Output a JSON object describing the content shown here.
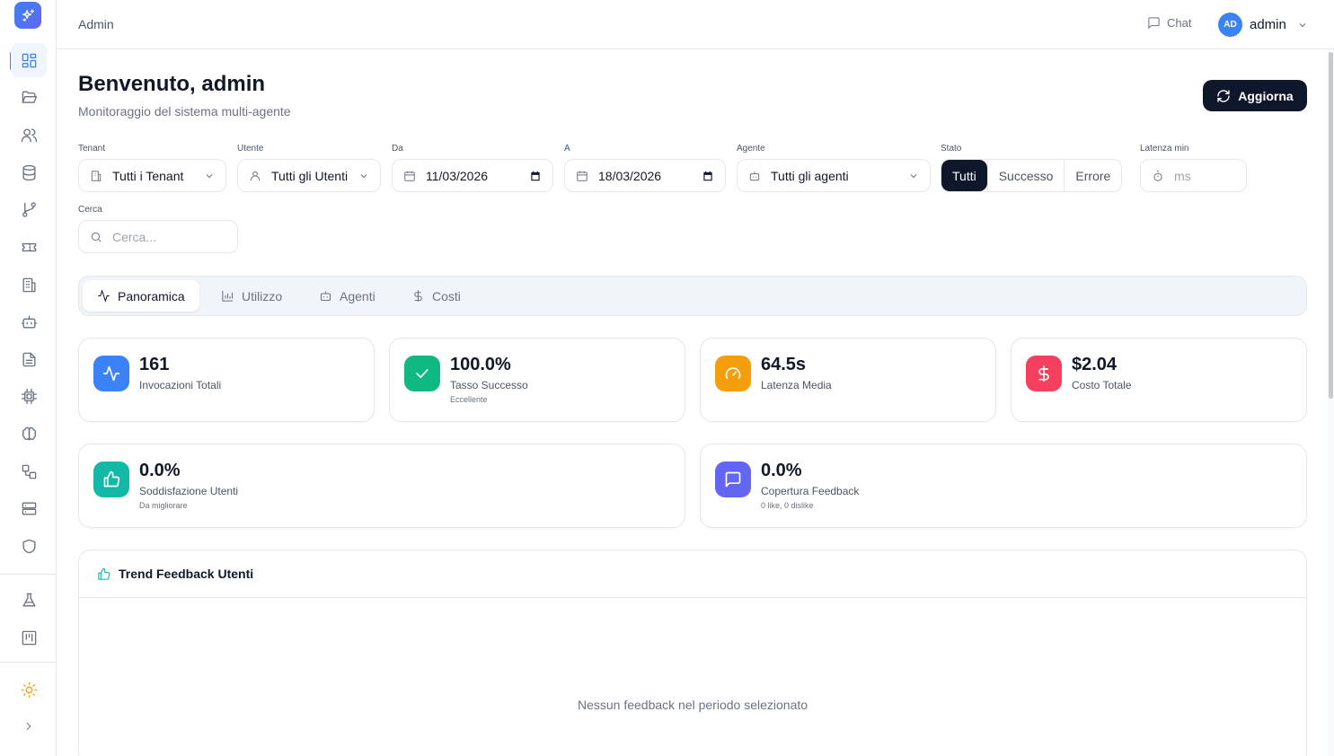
{
  "topbar": {
    "breadcrumb": "Admin",
    "chat_label": "Chat",
    "user_initials": "AD",
    "user_name": "admin"
  },
  "header": {
    "title": "Benvenuto, admin",
    "subtitle": "Monitoraggio del sistema multi-agente",
    "refresh_label": "Aggiorna"
  },
  "filters": {
    "tenant": {
      "label": "Tenant",
      "value": "Tutti i Tenant"
    },
    "user": {
      "label": "Utente",
      "value": "Tutti gli Utenti"
    },
    "from": {
      "label": "Da",
      "value": "11/03/2026"
    },
    "to": {
      "label": "A",
      "value": "18/03/2026"
    },
    "agent": {
      "label": "Agente",
      "value": "Tutti gli agenti"
    },
    "status": {
      "label": "Stato",
      "options": [
        "Tutti",
        "Successo",
        "Errore"
      ],
      "selected": "Tutti"
    },
    "latency": {
      "label": "Latenza min",
      "placeholder": "ms"
    },
    "search": {
      "label": "Cerca",
      "placeholder": "Cerca..."
    }
  },
  "tabs": [
    {
      "label": "Panoramica",
      "icon": "activity-icon",
      "active": true
    },
    {
      "label": "Utilizzo",
      "icon": "bar-chart-icon",
      "active": false
    },
    {
      "label": "Agenti",
      "icon": "bot-icon",
      "active": false
    },
    {
      "label": "Costi",
      "icon": "dollar-icon",
      "active": false
    }
  ],
  "stats": [
    {
      "value": "161",
      "label": "Invocazioni Totali",
      "sub": "",
      "icon": "activity-icon",
      "color": "#3b82f6"
    },
    {
      "value": "100.0%",
      "label": "Tasso Successo",
      "sub": "Eccellente",
      "icon": "check-icon",
      "color": "#10b981"
    },
    {
      "value": "64.5s",
      "label": "Latenza Media",
      "sub": "",
      "icon": "gauge-icon",
      "color": "#f59e0b"
    },
    {
      "value": "$2.04",
      "label": "Costo Totale",
      "sub": "",
      "icon": "dollar-icon",
      "color": "#f43f5e"
    },
    {
      "value": "0.0%",
      "label": "Soddisfazione Utenti",
      "sub": "Da migliorare",
      "icon": "thumbs-up-icon",
      "color": "#14b8a6"
    },
    {
      "value": "0.0%",
      "label": "Copertura Feedback",
      "sub": "0 like, 0 dislike",
      "icon": "message-icon",
      "color": "#6366f1"
    }
  ],
  "trend": {
    "title": "Trend Feedback Utenti",
    "empty_message": "Nessun feedback nel periodo selezionato"
  },
  "sidebar": {
    "items": [
      "dashboard-icon",
      "folder-icon",
      "users-icon",
      "database-icon",
      "git-branch-icon",
      "ticket-icon",
      "building-icon",
      "bot-icon",
      "file-text-icon",
      "cpu-icon",
      "brain-icon",
      "workflow-icon",
      "server-icon",
      "shield-icon",
      "flask-icon",
      "kanban-icon"
    ],
    "theme_icon": "sun-icon",
    "expand_icon": "chevron-right-icon"
  }
}
